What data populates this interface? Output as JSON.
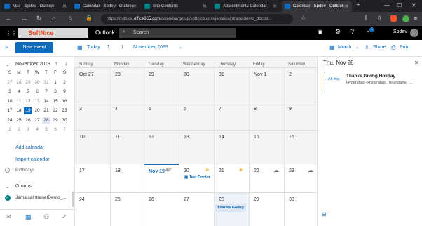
{
  "tabs": [
    {
      "label": "Mail - Spdev - Outlook",
      "color": "#0f6cbd"
    },
    {
      "label": "Calendar - Spdev - Outlook",
      "color": "#0f6cbd"
    },
    {
      "label": "Site Contents",
      "color": "#038387"
    },
    {
      "label": "Appointments Calendar",
      "color": "#038387"
    },
    {
      "label": "Calendar - Spdev - Outlook",
      "color": "#0f6cbd"
    }
  ],
  "new_tab": "+",
  "url": {
    "prefix": "https://outlook.",
    "domain": "office365.com",
    "rest": "/calendar/group/softnice.com/jamaicaintranetdemo_doctor..."
  },
  "header": {
    "brand": "SoftNice",
    "app": "Outlook",
    "search_placeholder": "Search",
    "user": "Spdev",
    "badge": "1"
  },
  "toolbar": {
    "new_event": "New event",
    "today": "Today",
    "month_label": "November 2019",
    "view": "Month",
    "share": "Share",
    "print": "Print"
  },
  "mini": {
    "title": "November 2019",
    "weekdays": [
      "S",
      "M",
      "T",
      "W",
      "T",
      "F",
      "S"
    ],
    "rows": [
      [
        "27",
        "28",
        "29",
        "30",
        "31",
        "1",
        "2"
      ],
      [
        "3",
        "4",
        "5",
        "6",
        "7",
        "8",
        "9"
      ],
      [
        "10",
        "11",
        "12",
        "13",
        "14",
        "15",
        "16"
      ],
      [
        "17",
        "18",
        "19",
        "20",
        "21",
        "22",
        "23"
      ],
      [
        "24",
        "25",
        "26",
        "27",
        "28",
        "29",
        "30"
      ],
      [
        "1",
        "2",
        "3",
        "4",
        "5",
        "6",
        "7"
      ]
    ]
  },
  "left_links": {
    "add": "Add calendar",
    "import": "Import calendar",
    "birthdays": "Birthdays",
    "groups": "Groups",
    "group_item": "JamaicaIntranetDemo_..."
  },
  "calendar": {
    "weekdays": [
      "Sunday",
      "Monday",
      "Tuesday",
      "Wednesday",
      "Thursday",
      "Friday",
      "Saturday"
    ],
    "weeks": [
      [
        "Oct 27",
        "28",
        "29",
        "30",
        "31",
        "Nov 1",
        "2"
      ],
      [
        "3",
        "4",
        "5",
        "6",
        "7",
        "8",
        "9"
      ],
      [
        "10",
        "11",
        "12",
        "13",
        "14",
        "15",
        "16"
      ],
      [
        "17",
        "18",
        "Nov 19",
        "20",
        "21",
        "22",
        "23"
      ],
      [
        "24",
        "25",
        "26",
        "27",
        "28",
        "29",
        "30"
      ]
    ],
    "weather": {
      "tue": "49°",
      "wed": "☀",
      "thu": "☀",
      "fri": "☁",
      "sat": "☁"
    },
    "event_test": "Test Doctor",
    "event_tg": "Thanks Giving"
  },
  "detail": {
    "date": "Thu, Nov 28",
    "allday": "All day",
    "title": "Thanks Giving Holiday",
    "location": "Hyderabad (Hyderabad, Telangana, I..."
  }
}
